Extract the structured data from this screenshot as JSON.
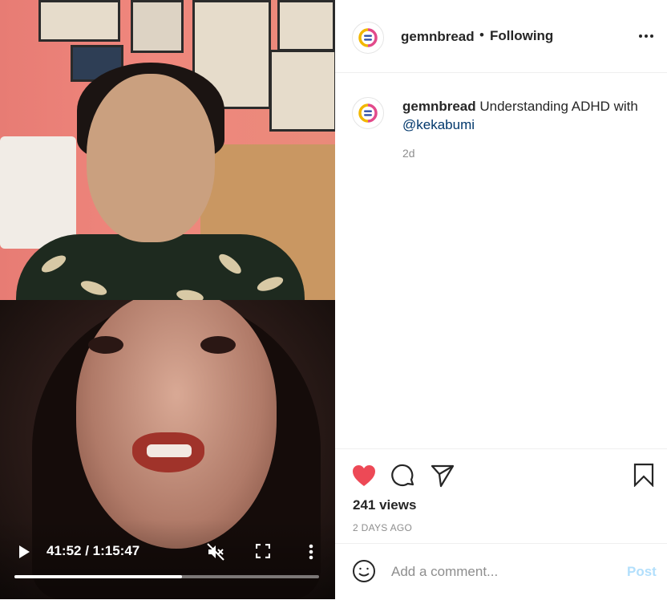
{
  "video": {
    "time": "41:52 / 1:15:47",
    "progress_fraction": 0.55,
    "icons": {
      "play": "play-icon",
      "mute": "muted-speaker-icon",
      "fullscreen": "fullscreen-icon",
      "more": "vertical-dots-icon"
    }
  },
  "header": {
    "username": "gemnbread",
    "separator": "•",
    "follow_status": "Following",
    "avatar_icon": "gem-and-bread-logo",
    "more_icon": "horizontal-dots-icon"
  },
  "caption": {
    "username": "gemnbread",
    "text": "Understanding ADHD with",
    "mention": "@kekabumi",
    "time": "2d"
  },
  "actions": {
    "like_icon": "heart-filled-icon",
    "comment_icon": "comment-bubble-icon",
    "share_icon": "paper-plane-icon",
    "save_icon": "bookmark-icon",
    "like_color": "#ed4956",
    "views": "241 views",
    "date": "2 DAYS AGO"
  },
  "comment": {
    "placeholder": "Add a comment...",
    "post_label": "Post",
    "emoji_icon": "smiley-face-icon",
    "post_color": "#b2dffc"
  }
}
